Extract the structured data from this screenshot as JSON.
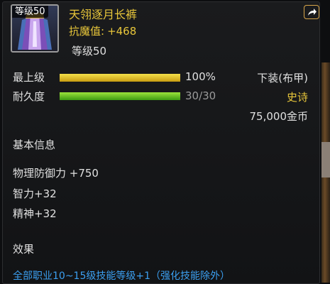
{
  "item": {
    "name": "天翎逐月长裤",
    "level_badge": "等级50",
    "magic_resist_label": "抗魔值:",
    "magic_resist_value": "+468",
    "level_text": "等级50",
    "icon": "purple-robe-item-icon"
  },
  "bars": {
    "quality": {
      "label": "最上级",
      "value_text": "100%",
      "fraction": 1.0
    },
    "durability": {
      "label": "耐久度",
      "value_text": "30/30",
      "fraction": 1.0
    }
  },
  "info": {
    "slot": "下装(布甲)",
    "rarity": "史诗",
    "price": "75,000金币"
  },
  "sections": {
    "basic_info": "基本信息",
    "effect": "效果"
  },
  "stats": [
    "物理防御力 +750",
    "智力+32",
    "精神+32"
  ],
  "effect_text": "全部职业10~15级技能等级+1（强化技能除外）",
  "colors": {
    "title_gold": "#e8c63a",
    "rarity_epic": "#e8c63a",
    "effect_blue": "#3b9ff0",
    "text_light": "#e0e0e0"
  },
  "icons": {
    "share": "share-icon"
  }
}
